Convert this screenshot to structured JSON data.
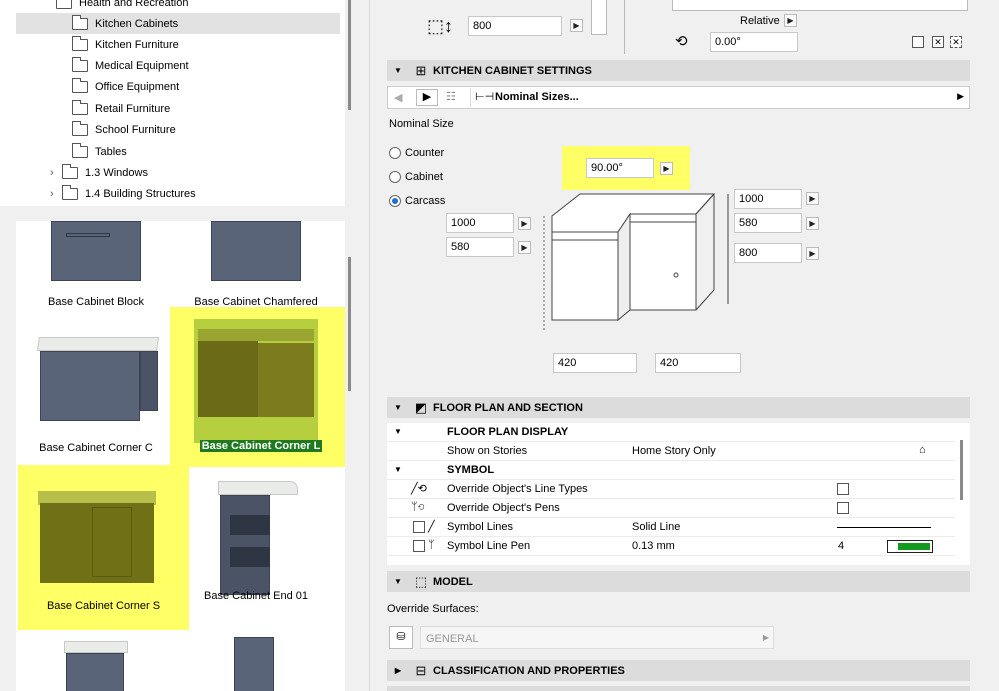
{
  "tree": {
    "items": [
      {
        "label": "Health and Recreation",
        "indent": 1
      },
      {
        "label": "Kitchen Cabinets",
        "indent": 1,
        "selected": true
      },
      {
        "label": "Kitchen Furniture",
        "indent": 1
      },
      {
        "label": "Medical Equipment",
        "indent": 1
      },
      {
        "label": "Office Equipment",
        "indent": 1
      },
      {
        "label": "Retail Furniture",
        "indent": 1
      },
      {
        "label": "School Furniture",
        "indent": 1
      },
      {
        "label": "Tables",
        "indent": 1
      },
      {
        "label": "1.3 Windows",
        "indent": 0,
        "collapsed": true
      },
      {
        "label": "1.4 Building Structures",
        "indent": 0,
        "collapsed": true
      }
    ]
  },
  "gallery": {
    "items": [
      {
        "label": "Base Cabinet Block"
      },
      {
        "label": "Base Cabinet Chamfered"
      },
      {
        "label": "Base Cabinet Corner C"
      },
      {
        "label": "Base Cabinet Corner L",
        "selected": true
      },
      {
        "label": "Base Cabinet Corner S",
        "highlighted": true
      },
      {
        "label": "Base Cabinet End 01"
      }
    ]
  },
  "top": {
    "height_value": "800",
    "relative_label": "Relative",
    "rotation_value": "0.00°"
  },
  "kitchen_settings": {
    "title": "KITCHEN CABINET SETTINGS",
    "dropdown": "Nominal Sizes...",
    "nominal_label": "Nominal Size",
    "radios": [
      {
        "label": "Counter",
        "checked": false
      },
      {
        "label": "Cabinet",
        "checked": false
      },
      {
        "label": "Carcass",
        "checked": true
      }
    ],
    "angle": "90.00°",
    "left_w": "1000",
    "left_d": "580",
    "right_w": "1000",
    "right_d": "580",
    "height": "800",
    "bottom_l": "420",
    "bottom_r": "420"
  },
  "floor_plan": {
    "title": "FLOOR PLAN AND SECTION",
    "rows": [
      {
        "name": "FLOOR PLAN DISPLAY",
        "value": "",
        "header": true
      },
      {
        "name": "Show on Stories",
        "value": "Home Story Only"
      },
      {
        "name": "SYMBOL",
        "value": "",
        "header": true
      },
      {
        "name": "Override Object's Line Types",
        "value": ""
      },
      {
        "name": "Override Object's Pens",
        "value": ""
      },
      {
        "name": "Symbol Lines",
        "value": "Solid Line"
      },
      {
        "name": "Symbol Line Pen",
        "value": "0.13 mm",
        "pen_num": "4"
      }
    ]
  },
  "model": {
    "title": "MODEL",
    "override_label": "Override Surfaces:",
    "surface_value": "GENERAL"
  },
  "classification": {
    "title": "CLASSIFICATION AND PROPERTIES"
  },
  "colors": {
    "highlight": "#ffff66",
    "selected_label_bg": "#1f7a1f",
    "cabinet": "#5a6478"
  }
}
